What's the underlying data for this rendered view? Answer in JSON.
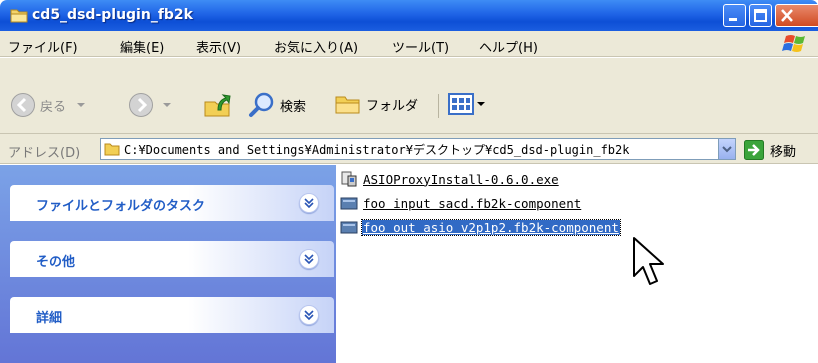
{
  "window": {
    "title": "cd5_dsd-plugin_fb2k",
    "folder_icon": "folder-icon",
    "buttons": [
      "minimize-icon",
      "maximize-icon",
      "close-icon"
    ]
  },
  "menu": {
    "items": [
      "ファイル(F)",
      "編集(E)",
      "表示(V)",
      "お気に入り(A)",
      "ツール(T)",
      "ヘルプ(H)"
    ]
  },
  "toolbar": {
    "back_label": "戻る",
    "search_label": "検索",
    "folders_label": "フォルダ"
  },
  "address": {
    "label": "アドレス(D)",
    "value": "C:¥Documents and Settings¥Administrator¥デスクトップ¥cd5_dsd-plugin_fb2k",
    "go_label": "移動"
  },
  "task_pane": {
    "panels": [
      {
        "title": "ファイルとフォルダのタスク"
      },
      {
        "title": "その他"
      },
      {
        "title": "詳細"
      }
    ]
  },
  "files": [
    {
      "name": "ASIOProxyInstall-0.6.0.exe",
      "icon": "installer-icon",
      "selected": false
    },
    {
      "name": "foo input sacd.fb2k-component",
      "icon": "component-file-icon",
      "selected": false
    },
    {
      "name": "foo out asio v2p1p2.fb2k-component",
      "icon": "component-file-icon",
      "selected": true
    }
  ],
  "colors": {
    "titlebar": "#1f64e6",
    "chrome": "#ece9d8",
    "task_pane": "#6f8fe0",
    "panel_title": "#215dc6",
    "selection": "#316ac5"
  }
}
